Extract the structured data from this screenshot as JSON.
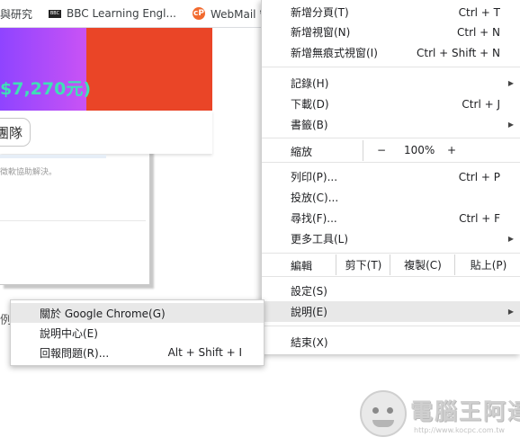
{
  "bookmarks": [
    {
      "label": "與研究",
      "icon": "none"
    },
    {
      "label": "BBC Learning Engl...",
      "icon": "bbc-icon",
      "icon_text": "BBC"
    },
    {
      "label": "WebMail 管",
      "icon": "webmail-icon",
      "icon_text": "cP"
    }
  ],
  "page": {
    "price": "$7,270元)",
    "button_label": "團隊",
    "faint_text": "徵軟協助解決。",
    "edge_text": "例"
  },
  "menu": {
    "new_tab": {
      "label": "新增分頁(T)",
      "shortcut": "Ctrl + T"
    },
    "new_window": {
      "label": "新增視窗(N)",
      "shortcut": "Ctrl + N"
    },
    "incognito": {
      "label": "新增無痕式視窗(I)",
      "shortcut": "Ctrl + Shift + N"
    },
    "history": {
      "label": "記錄(H)"
    },
    "downloads": {
      "label": "下載(D)",
      "shortcut": "Ctrl + J"
    },
    "bookmarks": {
      "label": "書籤(B)"
    },
    "zoom": {
      "label": "縮放",
      "minus": "−",
      "value": "100%",
      "plus": "+"
    },
    "print": {
      "label": "列印(P)...",
      "shortcut": "Ctrl + P"
    },
    "cast": {
      "label": "投放(C)..."
    },
    "find": {
      "label": "尋找(F)...",
      "shortcut": "Ctrl + F"
    },
    "more_tools": {
      "label": "更多工具(L)"
    },
    "edit": {
      "label": "編輯",
      "cut": "剪下(T)",
      "copy": "複製(C)",
      "paste": "貼上(P)"
    },
    "settings": {
      "label": "設定(S)"
    },
    "help": {
      "label": "說明(E)"
    },
    "exit": {
      "label": "結束(X)"
    },
    "submenu_arrow": "▶"
  },
  "help_submenu": {
    "about": {
      "label": "關於 Google Chrome(G)"
    },
    "help_center": {
      "label": "說明中心(E)"
    },
    "report": {
      "label": "回報問題(R)...",
      "shortcut": "Alt + Shift + I"
    }
  },
  "watermark": {
    "title": "電腦王阿達",
    "url": "http://www.kocpc.com.tw"
  },
  "colors": {
    "highlight": "#e8e8e8",
    "banner_purple": "#8f44ff",
    "banner_orange": "#ea4527",
    "price_green": "#3fe0b6"
  }
}
